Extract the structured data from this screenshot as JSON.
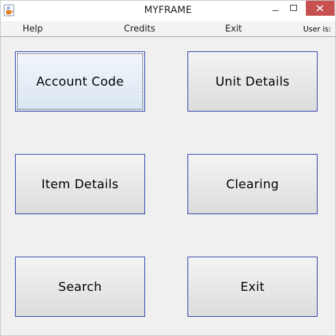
{
  "window": {
    "title": "MYFRAME",
    "app_icon": "java-coffee-cup-icon"
  },
  "title_controls": {
    "minimize_icon": "minimize-icon",
    "maximize_icon": "maximize-icon",
    "close_icon": "close-icon",
    "close_color": "#c75050"
  },
  "menubar": {
    "items": [
      {
        "label": "Help"
      },
      {
        "label": "Credits"
      },
      {
        "label": "Exit"
      }
    ],
    "user_label": "User is:"
  },
  "buttons": [
    {
      "label": "Account Code",
      "focused": true
    },
    {
      "label": "Unit Details"
    },
    {
      "label": "Item Details"
    },
    {
      "label": "Clearing"
    },
    {
      "label": "Search"
    },
    {
      "label": "Exit"
    }
  ],
  "colors": {
    "button_border": "#2a3aa8",
    "background": "#f0f0f0"
  }
}
